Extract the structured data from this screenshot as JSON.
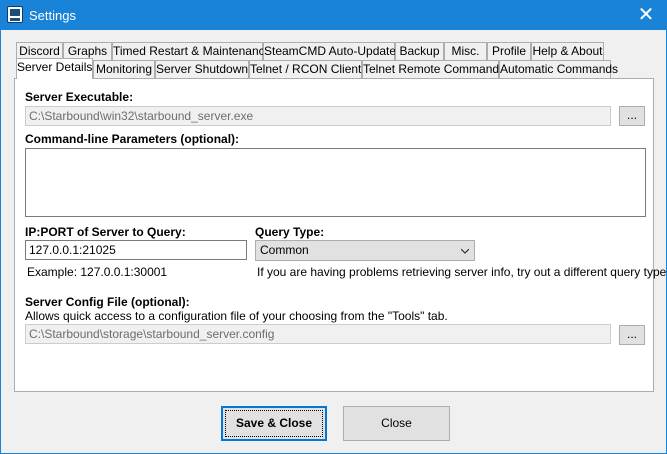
{
  "window": {
    "title": "Settings",
    "close_glyph": "✕",
    "icon": "monitor-app-icon"
  },
  "tabs": {
    "row1": [
      {
        "label": "Discord"
      },
      {
        "label": "Graphs"
      },
      {
        "label": "Timed Restart & Maintenance"
      },
      {
        "label": "SteamCMD Auto-Updates"
      },
      {
        "label": "Backup"
      },
      {
        "label": "Misc."
      },
      {
        "label": "Profile"
      },
      {
        "label": "Help & About"
      }
    ],
    "row2": [
      {
        "label": "Server Details",
        "active": true
      },
      {
        "label": "Monitoring"
      },
      {
        "label": "Server Shutdown"
      },
      {
        "label": "Telnet / RCON Client"
      },
      {
        "label": "Telnet Remote Commands"
      },
      {
        "label": "Automatic Commands"
      }
    ]
  },
  "server_details": {
    "executable_label": "Server Executable:",
    "executable_value": "C:\\Starbound\\win32\\starbound_server.exe",
    "browse_label": "...",
    "cmdline_label": "Command-line Parameters (optional):",
    "cmdline_value": "",
    "ipport_label": "IP:PORT of Server to Query:",
    "ipport_value": "127.0.0.1:21025",
    "ipport_example": "Example: 127.0.0.1:30001",
    "query_type_label": "Query Type:",
    "query_type_value": "Common",
    "query_type_hint": "If you are having problems retrieving server info, try out a different query type.",
    "config_label": "Server Config File (optional):",
    "config_hint": "Allows quick access to a configuration file of your choosing from the \"Tools\" tab.",
    "config_value": "C:\\Starbound\\storage\\starbound_server.config",
    "config_browse_label": "..."
  },
  "footer": {
    "save_label": "Save & Close",
    "close_label": "Close"
  },
  "colors": {
    "titlebar": "#1883d7",
    "accent": "#0078d7"
  }
}
